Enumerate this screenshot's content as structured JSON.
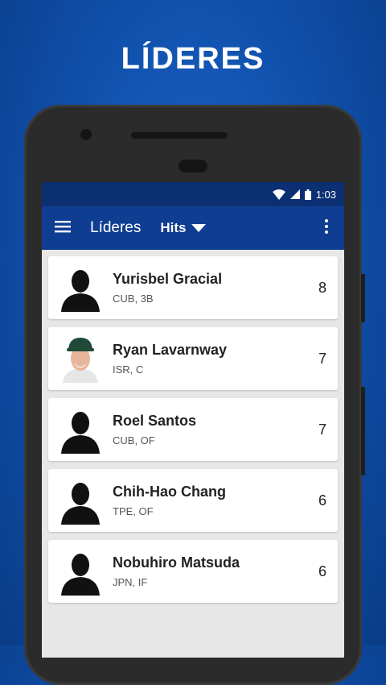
{
  "headline": "LÍDERES",
  "status_bar": {
    "time": "1:03"
  },
  "app_bar": {
    "title": "Líderes",
    "filter_label": "Hits"
  },
  "players": [
    {
      "name": "Yurisbel Gracial",
      "meta": "CUB, 3B",
      "value": "8",
      "avatar": "silhouette-icon"
    },
    {
      "name": "Ryan Lavarnway",
      "meta": "ISR, C",
      "value": "7",
      "avatar": "player-photo"
    },
    {
      "name": "Roel Santos",
      "meta": "CUB, OF",
      "value": "7",
      "avatar": "silhouette-icon"
    },
    {
      "name": "Chih-Hao Chang",
      "meta": "TPE, OF",
      "value": "6",
      "avatar": "silhouette-icon"
    },
    {
      "name": "Nobuhiro Matsuda",
      "meta": "JPN, IF",
      "value": "6",
      "avatar": "silhouette-icon"
    }
  ],
  "colors": {
    "background": "#1a63c9",
    "app_bar": "#0f3d92",
    "status_bar": "#0b2f73"
  }
}
